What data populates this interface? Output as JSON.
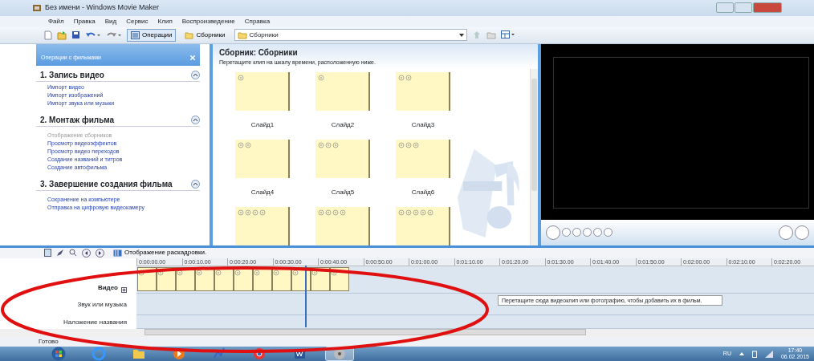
{
  "window": {
    "title": "Без имени - Windows Movie Maker"
  },
  "menu": [
    "Файл",
    "Правка",
    "Вид",
    "Сервис",
    "Клип",
    "Воспроизведение",
    "Справка"
  ],
  "toolbar": {
    "buttons": [
      {
        "label": "Операции",
        "selected": true
      },
      {
        "label": "Сборники",
        "selected": false
      }
    ],
    "collection_dropdown": "Сборники"
  },
  "tasks_pane": {
    "title": "Операции с фильмами",
    "sections": [
      {
        "title": "1. Запись видео",
        "expanded": true,
        "links": [
          {
            "label": "Импорт видео",
            "disabled": false
          },
          {
            "label": "Импорт изображений",
            "disabled": false
          },
          {
            "label": "Импорт звука или музыки",
            "disabled": false
          }
        ]
      },
      {
        "title": "2. Монтаж фильма",
        "expanded": true,
        "links": [
          {
            "label": "Отображение сборников",
            "disabled": true
          },
          {
            "label": "Просмотр видеоэффектов",
            "disabled": false
          },
          {
            "label": "Просмотр видео переходов",
            "disabled": false
          },
          {
            "label": "Создание названий и титров",
            "disabled": false
          },
          {
            "label": "Создание автофильма",
            "disabled": false
          }
        ]
      },
      {
        "title": "3. Завершение создания фильма",
        "expanded": true,
        "links": [
          {
            "label": "Сохранение на компьютере",
            "disabled": false
          },
          {
            "label": "Отправка на цифровую видеокамеру",
            "disabled": false
          }
        ]
      }
    ]
  },
  "collection": {
    "title": "Сборник: Сборники",
    "hint": "Перетащите клип на шкалу времени, расположенную ниже.",
    "clips": [
      {
        "kind": "slide",
        "label": "Слайд1"
      },
      {
        "kind": "slide",
        "label": "Слайд2"
      },
      {
        "kind": "slide",
        "label": "Слайд3"
      },
      {
        "kind": "slide",
        "label": "Слайд4"
      },
      {
        "kind": "slide",
        "label": "Слайд5"
      },
      {
        "kind": "slide",
        "label": "Слайд6"
      },
      {
        "kind": "slide"
      },
      {
        "kind": "slide"
      },
      {
        "kind": "slide"
      }
    ]
  },
  "timeline": {
    "view_label": "Отображение раскадровки.",
    "ruler": [
      "0:00:00.00",
      "0:00:10.00",
      "0:00:20.00",
      "0:00:30.00",
      "0:00:40.00",
      "0:00:50.00",
      "0:01:00.00",
      "0:01:10.00",
      "0:01:20.00",
      "0:01:30.00",
      "0:01:40.00",
      "0:01:50.00",
      "0:02:00.00",
      "0:02:10.00",
      "0:02:20.00"
    ],
    "tracks": [
      {
        "kind": "video",
        "label": "Видео",
        "expanded": false,
        "clips": [
          {
            "kind": "slide"
          },
          {
            "kind": "slide"
          },
          {
            "kind": "slide"
          },
          {
            "kind": "slide"
          },
          {
            "kind": "slide"
          },
          {
            "kind": "slide"
          },
          {
            "kind": "slide"
          },
          {
            "kind": "slide"
          },
          {
            "kind": "slide"
          },
          {
            "kind": "slide"
          },
          {
            "kind": "slide"
          }
        ]
      },
      {
        "kind": "audio",
        "label": "Звук или музыка"
      },
      {
        "kind": "title",
        "label": "Наложение названия"
      }
    ],
    "tooltip": "Перетащите сюда видеоклип или фотографию, чтобы добавить их в фильм."
  },
  "status_bar": "Готово",
  "taskbar": {
    "language": "RU",
    "time": "17:40",
    "date": "06.02.2015"
  }
}
